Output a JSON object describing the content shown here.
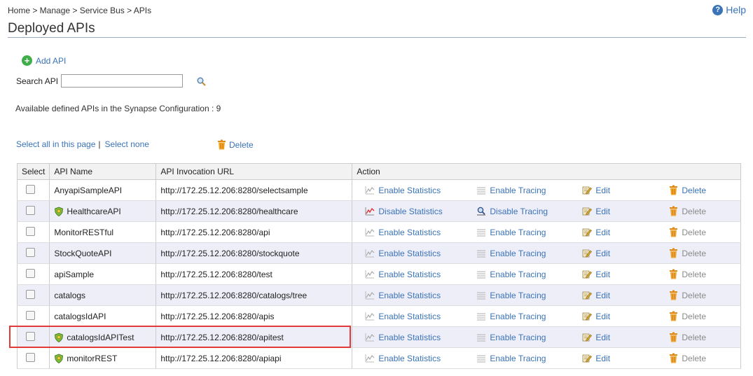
{
  "breadcrumb": "Home > Manage > Service Bus > APIs",
  "help_label": "Help",
  "title": "Deployed APIs",
  "add_api_label": "Add API",
  "search": {
    "label": "Search API",
    "value": "",
    "placeholder": ""
  },
  "available_text": "Available defined APIs in the Synapse Configuration : 9",
  "select_all_label": "Select all in this page",
  "select_sep": "|",
  "select_none_label": "Select none",
  "top_delete_label": "Delete",
  "table": {
    "headers": [
      "Select",
      "API Name",
      "API Invocation URL",
      "Action"
    ],
    "rows": [
      {
        "name": "AnyapiSampleAPI",
        "url": "http://172.25.12.206:8280/selectsample",
        "icon": false,
        "stats": "Enable Statistics",
        "tracing": "Enable Tracing",
        "stats_active": false,
        "tracing_active": false,
        "edit": "Edit",
        "delete": "Delete",
        "delete_enabled": true
      },
      {
        "name": "HealthcareAPI",
        "url": "http://172.25.12.206:8280/healthcare",
        "icon": true,
        "stats": "Disable Statistics",
        "tracing": "Disable Tracing",
        "stats_active": true,
        "tracing_active": true,
        "edit": "Edit",
        "delete": "Delete",
        "delete_enabled": false
      },
      {
        "name": "MonitorRESTful",
        "url": "http://172.25.12.206:8280/api",
        "icon": false,
        "stats": "Enable Statistics",
        "tracing": "Enable Tracing",
        "stats_active": false,
        "tracing_active": false,
        "edit": "Edit",
        "delete": "Delete",
        "delete_enabled": false
      },
      {
        "name": "StockQuoteAPI",
        "url": "http://172.25.12.206:8280/stockquote",
        "icon": false,
        "stats": "Enable Statistics",
        "tracing": "Enable Tracing",
        "stats_active": false,
        "tracing_active": false,
        "edit": "Edit",
        "delete": "Delete",
        "delete_enabled": false
      },
      {
        "name": "apiSample",
        "url": "http://172.25.12.206:8280/test",
        "icon": false,
        "stats": "Enable Statistics",
        "tracing": "Enable Tracing",
        "stats_active": false,
        "tracing_active": false,
        "edit": "Edit",
        "delete": "Delete",
        "delete_enabled": false
      },
      {
        "name": "catalogs",
        "url": "http://172.25.12.206:8280/catalogs/tree",
        "icon": false,
        "stats": "Enable Statistics",
        "tracing": "Enable Tracing",
        "stats_active": false,
        "tracing_active": false,
        "edit": "Edit",
        "delete": "Delete",
        "delete_enabled": false
      },
      {
        "name": "catalogsIdAPI",
        "url": "http://172.25.12.206:8280/apis",
        "icon": false,
        "stats": "Enable Statistics",
        "tracing": "Enable Tracing",
        "stats_active": false,
        "tracing_active": false,
        "edit": "Edit",
        "delete": "Delete",
        "delete_enabled": false
      },
      {
        "name": "catalogsIdAPITest",
        "url": "http://172.25.12.206:8280/apitest",
        "icon": true,
        "stats": "Enable Statistics",
        "tracing": "Enable Tracing",
        "stats_active": false,
        "tracing_active": false,
        "edit": "Edit",
        "delete": "Delete",
        "delete_enabled": false
      },
      {
        "name": "monitorREST",
        "url": "http://172.25.12.206:8280/apiapi",
        "icon": true,
        "stats": "Enable Statistics",
        "tracing": "Enable Tracing",
        "stats_active": false,
        "tracing_active": false,
        "edit": "Edit",
        "delete": "Delete",
        "delete_enabled": false
      }
    ]
  },
  "colors": {
    "link": "#3a73b8",
    "highlight": "#e03a3a",
    "alt_row": "#eeeef8"
  }
}
